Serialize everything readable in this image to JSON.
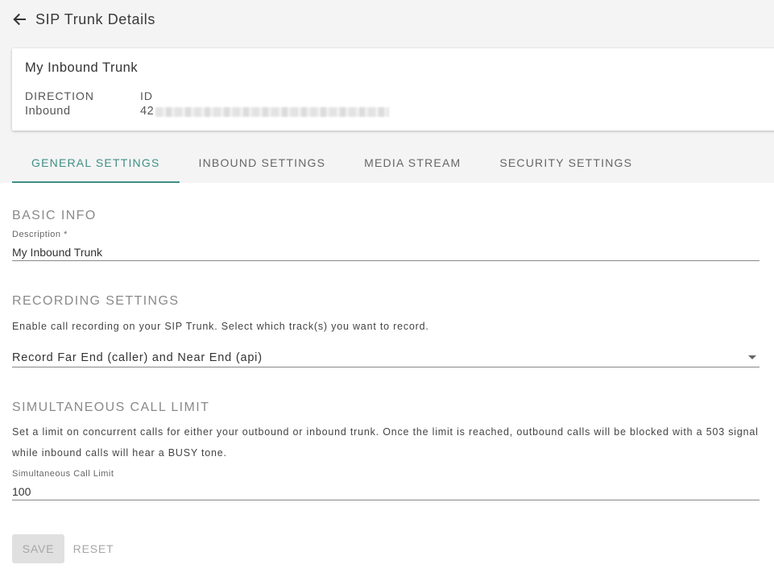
{
  "header": {
    "title": "SIP Trunk Details"
  },
  "card": {
    "name": "My Inbound Trunk",
    "direction_label": "DIRECTION",
    "direction_value": "Inbound",
    "id_label": "ID",
    "id_value_visible": "42"
  },
  "tabs": [
    {
      "label": "GENERAL SETTINGS",
      "active": true
    },
    {
      "label": "INBOUND SETTINGS",
      "active": false
    },
    {
      "label": "MEDIA STREAM",
      "active": false
    },
    {
      "label": "SECURITY SETTINGS",
      "active": false
    }
  ],
  "basic_info": {
    "title": "BASIC INFO",
    "description_label": "Description *",
    "description_value": "My Inbound Trunk"
  },
  "recording": {
    "title": "RECORDING SETTINGS",
    "help": "Enable call recording on your SIP Trunk. Select which track(s) you want to record.",
    "selected": "Record Far End (caller) and Near End (api)"
  },
  "call_limit": {
    "title": "SIMULTANEOUS CALL LIMIT",
    "help": "Set a limit on concurrent calls for either your outbound or inbound trunk. Once the limit is reached, outbound calls will be blocked with a 503 signal while inbound calls will hear a BUSY tone.",
    "field_label": "Simultaneous Call Limit",
    "field_value": "100"
  },
  "actions": {
    "save_label": "SAVE",
    "reset_label": "RESET"
  },
  "colors": {
    "accent": "#3f8f86",
    "top_background": "#f4f4f4"
  },
  "icons": {
    "back": "arrow-left-icon",
    "dropdown": "caret-down-icon"
  }
}
